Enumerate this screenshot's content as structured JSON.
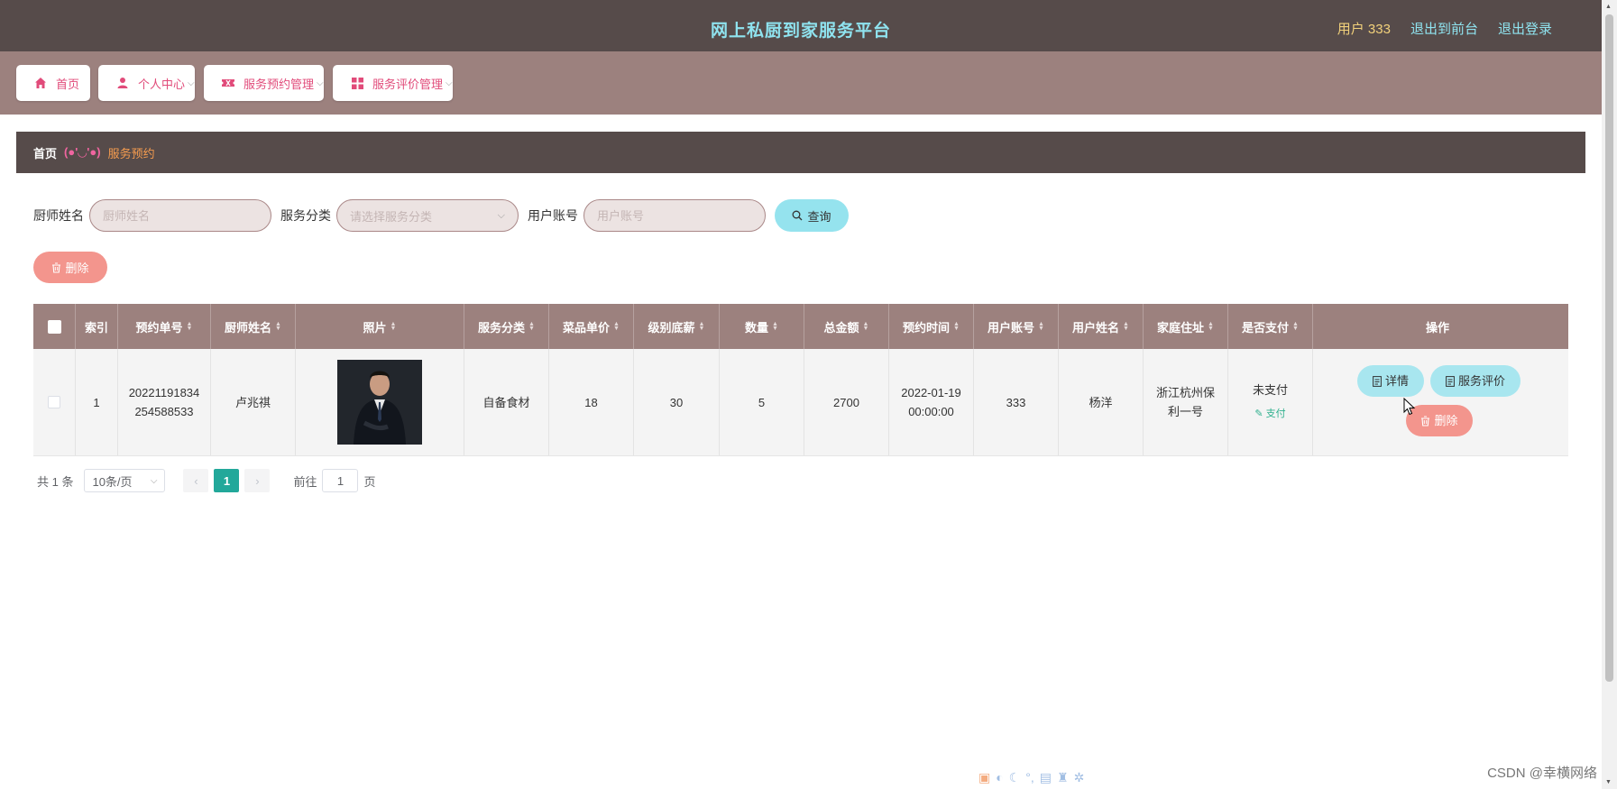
{
  "header": {
    "title": "网上私厨到家服务平台",
    "user_label": "用户 333",
    "to_front": "退出到前台",
    "logout": "退出登录"
  },
  "nav": {
    "items": [
      {
        "label": "首页",
        "icon": "home-icon",
        "has_dropdown": false
      },
      {
        "label": "个人中心",
        "icon": "user-icon",
        "has_dropdown": true
      },
      {
        "label": "服务预约管理",
        "icon": "ticket-icon",
        "has_dropdown": true
      },
      {
        "label": "服务评价管理",
        "icon": "grid-icon",
        "has_dropdown": true
      }
    ]
  },
  "breadcrumb": {
    "home": "首页",
    "separator": "(●'◡'●)",
    "current": "服务预约"
  },
  "search": {
    "chef_name_label": "厨师姓名",
    "chef_name_placeholder": "厨师姓名",
    "category_label": "服务分类",
    "category_placeholder": "请选择服务分类",
    "account_label": "用户账号",
    "account_placeholder": "用户账号",
    "query_button": "查询"
  },
  "toolbar": {
    "delete_label": "删除"
  },
  "table": {
    "columns": [
      "索引",
      "预约单号",
      "厨师姓名",
      "照片",
      "服务分类",
      "菜品单价",
      "级别底薪",
      "数量",
      "总金额",
      "预约时间",
      "用户账号",
      "用户姓名",
      "家庭住址",
      "是否支付",
      "操作"
    ],
    "rows": [
      {
        "index": "1",
        "order_no": "20221191834254588533",
        "chef_name": "卢兆祺",
        "category": "自备食材",
        "unit_price": "18",
        "base_salary": "30",
        "quantity": "5",
        "total": "2700",
        "time": "2022-01-19 00:00:00",
        "account": "333",
        "user_name": "杨洋",
        "address": "浙江杭州保利一号",
        "paid": "未支付",
        "pay_action": "支付",
        "actions": {
          "detail": "详情",
          "review": "服务评价",
          "delete": "删除"
        }
      }
    ]
  },
  "pagination": {
    "total_text": "共 1 条",
    "page_size": "10条/页",
    "current_page": "1",
    "goto_prefix": "前往",
    "goto_value": "1",
    "goto_suffix": "页"
  },
  "watermark": "CSDN @幸横网络",
  "colors": {
    "header_bg": "#564b4a",
    "nav_bg": "#9c817e",
    "title": "#8fe3ef",
    "accent_pink": "#e14b7a",
    "query_btn": "#95e3ee",
    "delete_btn": "#f3958d",
    "page_active": "#22a89a"
  }
}
